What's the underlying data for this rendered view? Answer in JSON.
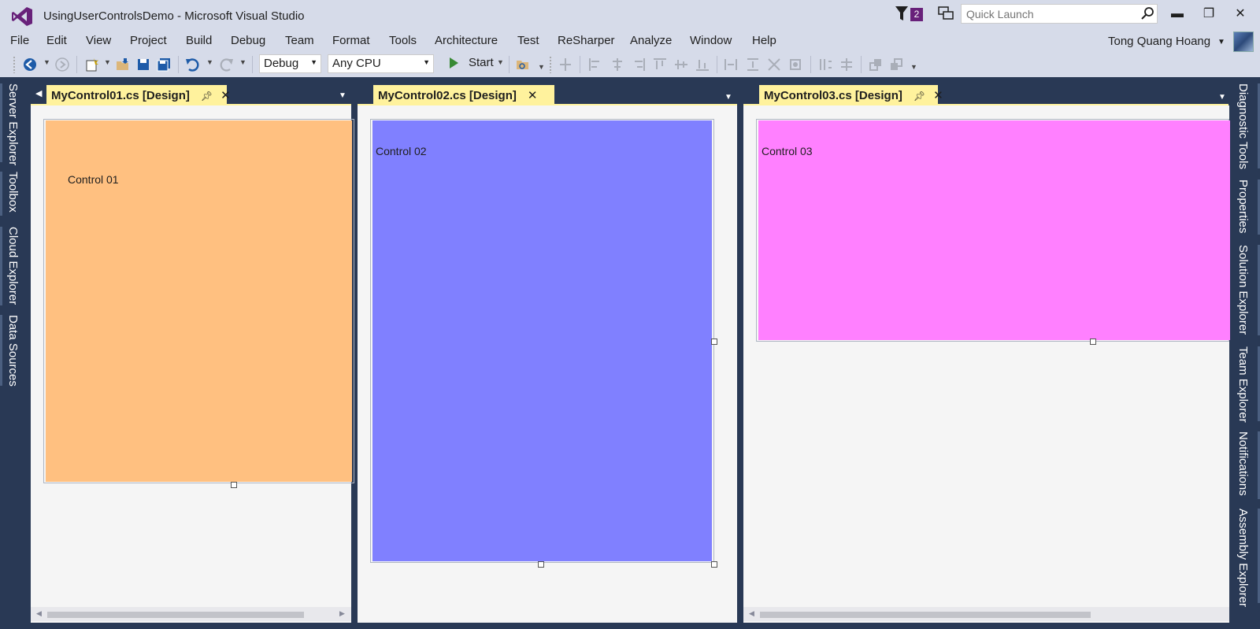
{
  "window": {
    "title": "UsingUserControlsDemo - Microsoft Visual Studio",
    "notification_count": "2",
    "quick_launch_placeholder": "Quick Launch",
    "controls": {
      "minimize": "▬",
      "restore": "❐",
      "close": "✕"
    }
  },
  "menu": {
    "items": [
      "File",
      "Edit",
      "View",
      "Project",
      "Build",
      "Debug",
      "Team",
      "Format",
      "Tools",
      "Architecture",
      "Test",
      "ReSharper",
      "Analyze",
      "Window",
      "Help"
    ],
    "user_name": "Tong Quang Hoang"
  },
  "toolbar": {
    "configuration": "Debug",
    "platform": "Any CPU",
    "start_label": "Start"
  },
  "left_tool_windows": [
    "Server Explorer",
    "Toolbox",
    "Cloud Explorer",
    "Data Sources"
  ],
  "right_tool_windows": [
    "Diagnostic Tools",
    "Properties",
    "Solution Explorer",
    "Team Explorer",
    "Notifications",
    "Assembly Explorer"
  ],
  "documents": [
    {
      "tab": "MyControl01.cs [Design]",
      "control_label": "Control 01",
      "color": "#ffc080"
    },
    {
      "tab": "MyControl02.cs [Design]",
      "control_label": "Control 02",
      "color": "#8080ff"
    },
    {
      "tab": "MyControl03.cs [Design]",
      "control_label": "Control 03",
      "color": "#ff80ff"
    }
  ],
  "colors": {
    "frame": "#293955",
    "chrome": "#d6dbe9",
    "tab_active": "#fff29d",
    "vs_purple": "#68217a"
  }
}
